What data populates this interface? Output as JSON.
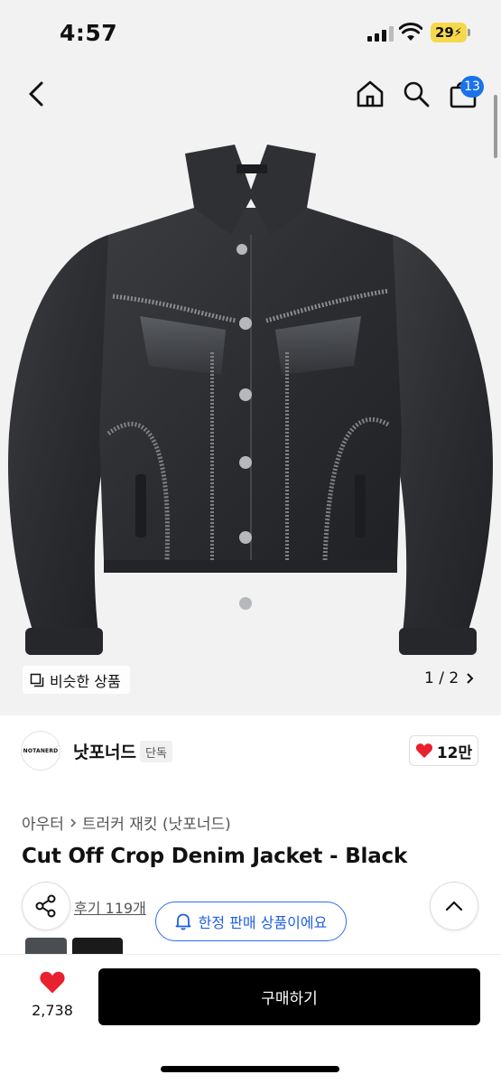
{
  "status": {
    "time": "4:57",
    "battery": "29"
  },
  "nav": {
    "cart_count": "13"
  },
  "gallery": {
    "similar_label": "비슷한 상품",
    "pager": "1 / 2"
  },
  "brand": {
    "logo_text": "NOTANERD",
    "name": "낫포너드",
    "tag": "단독",
    "likes": "12만"
  },
  "product": {
    "breadcrumb": [
      "아우터",
      "트러커 재킷 (낫포너드)"
    ],
    "title": "Cut Off Crop Denim Jacket - Black",
    "reviews": "후기 119개",
    "limited_label": "한정 판매 상품이에요"
  },
  "bottom": {
    "wish_count": "2,738",
    "buy_label": "구매하기"
  },
  "colors": {
    "accent_blue": "#2f6df6",
    "heart_red": "#e8202f",
    "badge_blue": "#1a73e8"
  }
}
